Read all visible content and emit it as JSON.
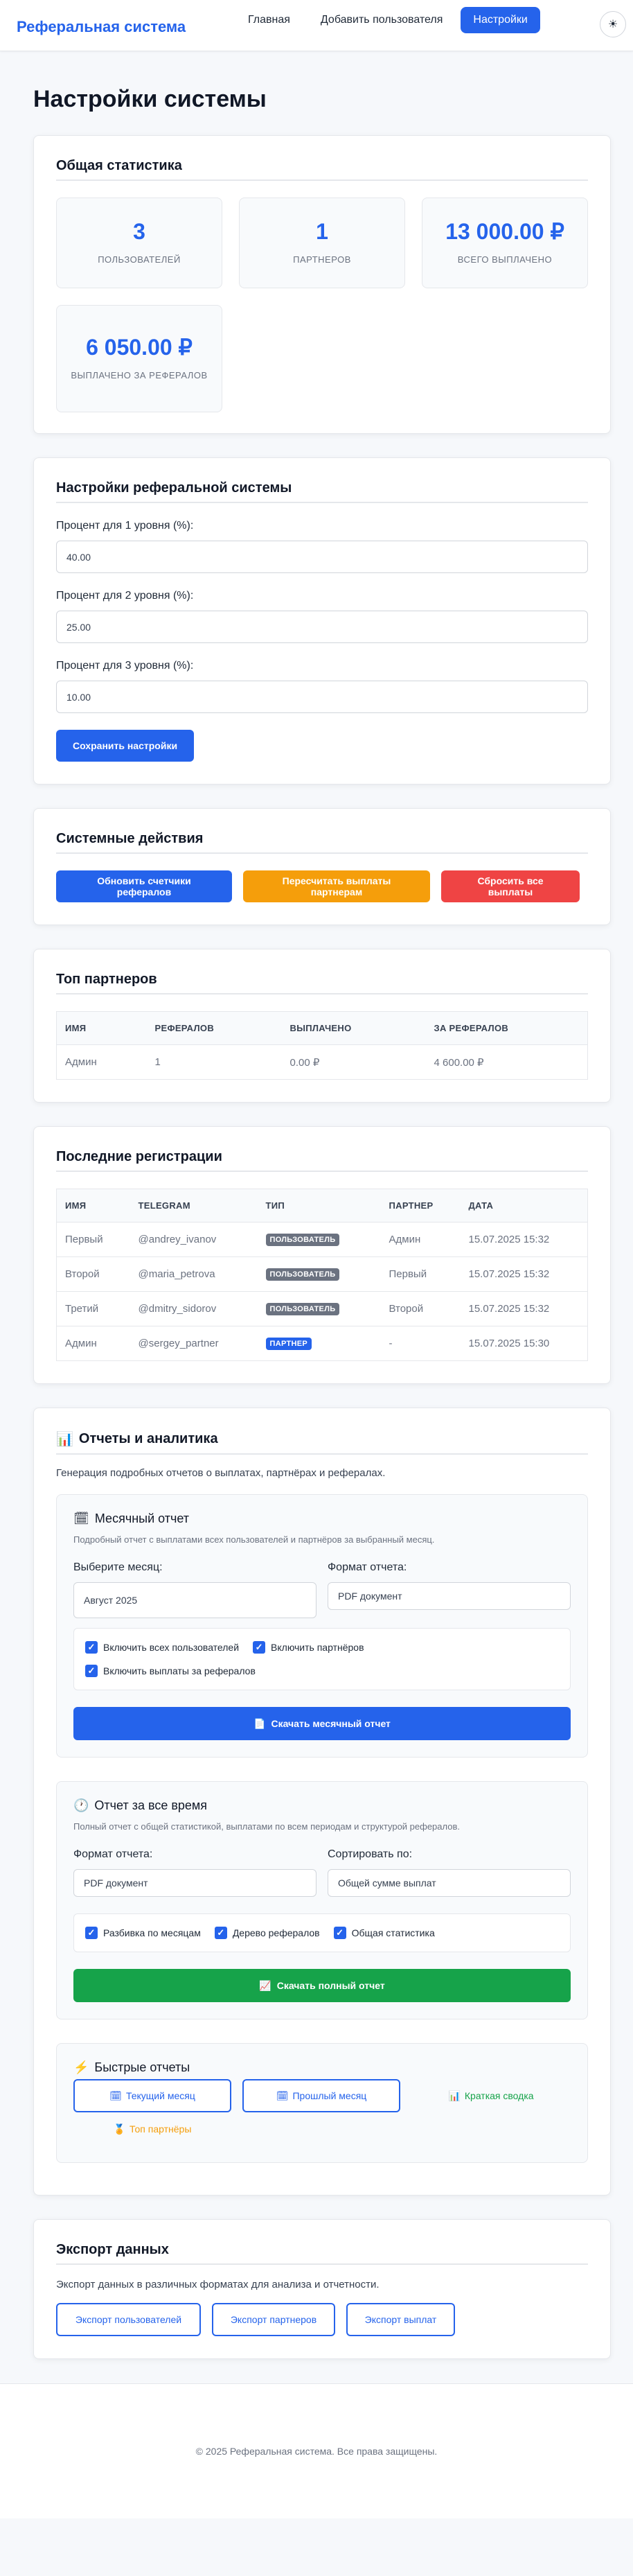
{
  "brand": "Реферальная система",
  "nav": {
    "home": "Главная",
    "add_user": "Добавить пользователя",
    "settings": "Настройки"
  },
  "theme_icon": "☀",
  "page_title": "Настройки системы",
  "stats": {
    "title": "Общая статистика",
    "items": [
      {
        "value": "3",
        "label": "ПОЛЬЗОВАТЕЛЕЙ"
      },
      {
        "value": "1",
        "label": "ПАРТНЕРОВ"
      },
      {
        "value": "13 000.00 ₽",
        "label": "ВСЕГО ВЫПЛАЧЕНО"
      },
      {
        "value": "6 050.00 ₽",
        "label": "ВЫПЛАЧЕНО ЗА РЕФЕРАЛОВ"
      }
    ]
  },
  "referral": {
    "title": "Настройки реферальной системы",
    "fields": [
      {
        "label": "Процент для 1 уровня (%):",
        "value": "40.00"
      },
      {
        "label": "Процент для 2 уровня (%):",
        "value": "25.00"
      },
      {
        "label": "Процент для 3 уровня (%):",
        "value": "10.00"
      }
    ],
    "save": "Сохранить настройки"
  },
  "actions": {
    "title": "Системные действия",
    "update": "Обновить счетчики рефералов",
    "recalc": "Пересчитать выплаты партнерам",
    "reset": "Сбросить все выплаты"
  },
  "top": {
    "title": "Топ партнеров",
    "headers": [
      "ИМЯ",
      "РЕФЕРАЛОВ",
      "ВЫПЛАЧЕНО",
      "ЗА РЕФЕРАЛОВ"
    ],
    "rows": [
      [
        "Админ",
        "1",
        "0.00 ₽",
        "4 600.00 ₽"
      ]
    ]
  },
  "recent": {
    "title": "Последние регистрации",
    "headers": [
      "ИМЯ",
      "TELEGRAM",
      "ТИП",
      "ПАРТНЕР",
      "ДАТА"
    ],
    "rows": [
      {
        "name": "Первый",
        "tg": "@andrey_ivanov",
        "type": "ПОЛЬЗОВАТЕЛЬ",
        "partner": "Админ",
        "date": "15.07.2025 15:32"
      },
      {
        "name": "Второй",
        "tg": "@maria_petrova",
        "type": "ПОЛЬЗОВАТЕЛЬ",
        "partner": "Первый",
        "date": "15.07.2025 15:32"
      },
      {
        "name": "Третий",
        "tg": "@dmitry_sidorov",
        "type": "ПОЛЬЗОВАТЕЛЬ",
        "partner": "Второй",
        "date": "15.07.2025 15:32"
      },
      {
        "name": "Админ",
        "tg": "@sergey_partner",
        "type": "ПАРТНЕР",
        "partner": "-",
        "date": "15.07.2025 15:30"
      }
    ]
  },
  "reports": {
    "icon": "📊",
    "title": "Отчеты и аналитика",
    "desc": "Генерация подробных отчетов о выплатах, партнёрах и рефералах.",
    "monthly": {
      "icon": "🗓",
      "title": "Месячный отчет",
      "desc": "Подробный отчет с выплатами всех пользователей и партнёров за выбранный месяц.",
      "month_label": "Выберите месяц:",
      "month_value": "Август 2025",
      "format_label": "Формат отчета:",
      "format_value": "PDF документ",
      "checks": [
        "Включить всех пользователей",
        "Включить партнёров",
        "Включить выплаты за рефералов"
      ],
      "button_icon": "📄",
      "button": "Скачать месячный отчет"
    },
    "alltime": {
      "icon": "🕐",
      "title": "Отчет за все время",
      "desc": "Полный отчет с общей статистикой, выплатами по всем периодам и структурой рефералов.",
      "format_label": "Формат отчета:",
      "format_value": "PDF документ",
      "sort_label": "Сортировать по:",
      "sort_value": "Общей сумме выплат",
      "checks": [
        "Разбивка по месяцам",
        "Дерево рефералов",
        "Общая статистика"
      ],
      "button_icon": "📈",
      "button": "Скачать полный отчет"
    },
    "quick": {
      "icon": "⚡",
      "title": "Быстрые отчеты",
      "current_icon": "🗓",
      "current": "Текущий месяц",
      "previous_icon": "🗓",
      "previous": "Прошлый месяц",
      "summary_icon": "📊",
      "summary": "Краткая сводка",
      "top_icon": "🏅",
      "top": "Топ партнёры"
    }
  },
  "export": {
    "title": "Экспорт данных",
    "desc": "Экспорт данных в различных форматах для анализа и отчетности.",
    "users": "Экспорт пользователей",
    "partners": "Экспорт партнеров",
    "payouts": "Экспорт выплат"
  },
  "footer": "© 2025 Реферальная система. Все права защищены.",
  "colors": {
    "accent": "#2563eb",
    "orange": "#f59e0b",
    "red": "#ef4444",
    "green": "#16a34a"
  }
}
